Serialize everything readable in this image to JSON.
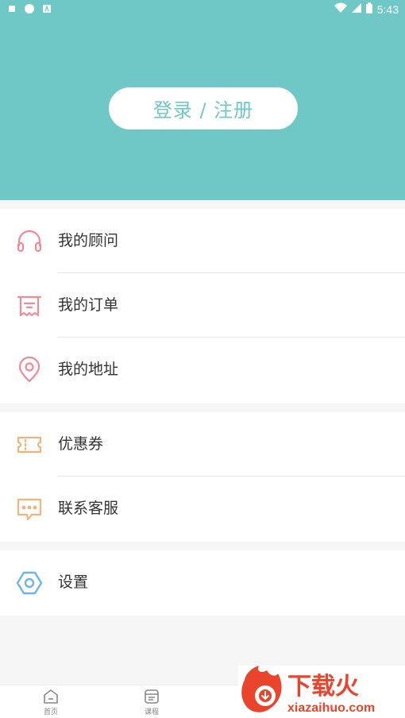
{
  "status_bar": {
    "time": "5:43",
    "left_icons": [
      "sim-icon",
      "cn-icon",
      "a-icon"
    ],
    "right_icons": [
      "wifi-icon",
      "signal-icon",
      "battery-icon"
    ]
  },
  "header": {
    "login_label": "登录 / 注册",
    "bg_color": "#6fc8c5"
  },
  "menu_groups": [
    {
      "items": [
        {
          "label": "我的顾问",
          "icon": "headphones-icon",
          "color": "#f28a96"
        },
        {
          "label": "我的订单",
          "icon": "receipt-icon",
          "color": "#f28a96"
        },
        {
          "label": "我的地址",
          "icon": "location-pin-icon",
          "color": "#f28a96"
        }
      ]
    },
    {
      "items": [
        {
          "label": "优惠券",
          "icon": "ticket-icon",
          "color": "#f4b27c"
        },
        {
          "label": "联系客服",
          "icon": "chat-bubble-icon",
          "color": "#f4b27c"
        }
      ]
    },
    {
      "items": [
        {
          "label": "设置",
          "icon": "hexagon-settings-icon",
          "color": "#6fb3e8"
        }
      ]
    }
  ],
  "tab_bar": {
    "tabs": [
      {
        "label": "首页",
        "icon": "home-icon"
      },
      {
        "label": "课程",
        "icon": "course-icon"
      }
    ]
  },
  "watermark": {
    "title": "下载火",
    "subtitle": "xiazaihuo.com",
    "color": "#e8452c"
  }
}
